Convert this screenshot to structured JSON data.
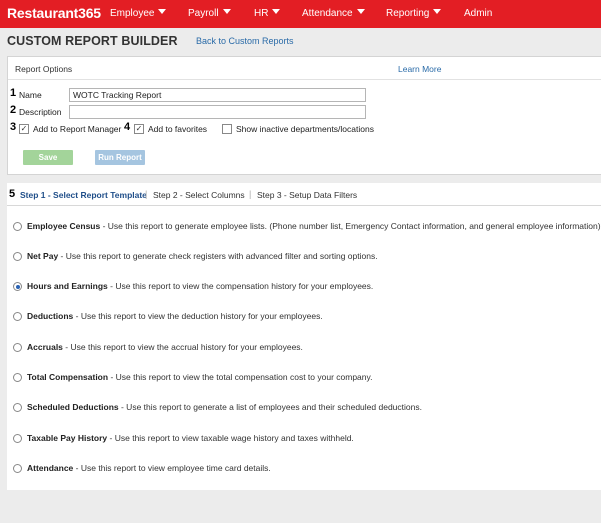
{
  "nav": {
    "logo": "Restaurant365",
    "items": [
      {
        "label": "Employee",
        "dropdown": true
      },
      {
        "label": "Payroll",
        "dropdown": true
      },
      {
        "label": "HR",
        "dropdown": true
      },
      {
        "label": "Attendance",
        "dropdown": true
      },
      {
        "label": "Reporting",
        "dropdown": true
      },
      {
        "label": "Admin",
        "dropdown": false
      }
    ],
    "color": "#e31e24"
  },
  "header": {
    "title": "CUSTOM REPORT BUILDER",
    "back_link": "Back to Custom Reports"
  },
  "options": {
    "title": "Report Options",
    "learn_more": "Learn More",
    "markers": [
      "1",
      "2",
      "3",
      "4",
      "5"
    ],
    "name_label": "Name",
    "name_value": "WOTC Tracking Report",
    "description_label": "Description",
    "description_value": "",
    "add_to_manager": {
      "label": "Add to Report Manager",
      "checked": true
    },
    "add_to_favorites": {
      "label": "Add to favorites",
      "checked": true
    },
    "show_inactive": {
      "label": "Show inactive departments/locations",
      "checked": false
    },
    "save_label": "Save",
    "run_label": "Run Report"
  },
  "steps": {
    "items": [
      {
        "label": "Step 1 - Select Report Template",
        "active": true
      },
      {
        "label": "Step 2 - Select Columns",
        "active": false
      },
      {
        "label": "Step 3 - Setup Data Filters",
        "active": false
      }
    ],
    "separator": "|"
  },
  "templates": [
    {
      "name": "Employee Census",
      "desc": " - Use this report to generate employee lists. (Phone number list, Emergency Contact information, and general employee information)",
      "selected": false
    },
    {
      "name": "Net Pay",
      "desc": " - Use this report to generate check registers with advanced filter and sorting options.",
      "selected": false
    },
    {
      "name": "Hours and Earnings",
      "desc": " - Use this report to view the compensation history for your employees.",
      "selected": true
    },
    {
      "name": "Deductions",
      "desc": " - Use this report to view the deduction history for your employees.",
      "selected": false
    },
    {
      "name": "Accruals",
      "desc": " - Use this report to view the accrual history for your employees.",
      "selected": false
    },
    {
      "name": "Total Compensation",
      "desc": " - Use this report to view the total compensation cost to your company.",
      "selected": false
    },
    {
      "name": "Scheduled Deductions",
      "desc": " - Use this report to generate a list of employees and their scheduled deductions.",
      "selected": false
    },
    {
      "name": "Taxable Pay History",
      "desc": " - Use this report to view taxable wage history and taxes withheld.",
      "selected": false
    },
    {
      "name": "Attendance",
      "desc": " - Use this report to view employee time card details.",
      "selected": false
    }
  ]
}
